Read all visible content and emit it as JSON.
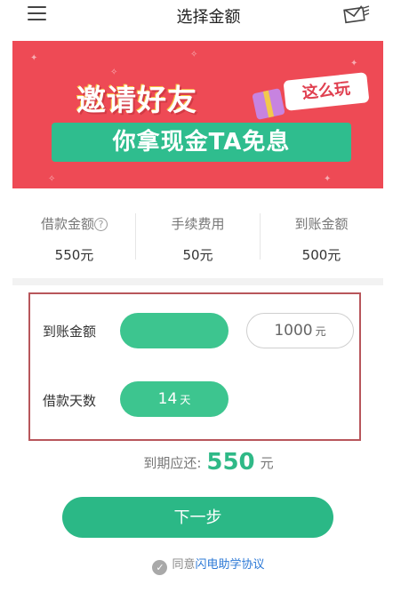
{
  "header": {
    "title": "选择金额",
    "menu_icon": "menu-icon",
    "mail_icon": "mail-icon"
  },
  "banner": {
    "headline": "邀请好友",
    "tag": "这么玩",
    "subline": "你拿现金TA免息",
    "colors": {
      "background": "#ee4a55",
      "strip": "#2fbd8e"
    }
  },
  "fees": [
    {
      "label": "借款金额",
      "value": "550元",
      "has_help_icon": true
    },
    {
      "label": "手续费用",
      "value": "50元"
    },
    {
      "label": "到账金额",
      "value": "500元"
    }
  ],
  "amount_selector": {
    "label": "到账金额",
    "options": [
      {
        "value": "",
        "unit": "",
        "selected": true
      },
      {
        "value": "1000",
        "unit": "元",
        "selected": false
      }
    ]
  },
  "days_selector": {
    "label": "借款天数",
    "options": [
      {
        "value": "14",
        "unit": "天",
        "selected": true
      }
    ]
  },
  "due": {
    "label": "到期应还:",
    "amount": "550",
    "unit": "元"
  },
  "next_button": {
    "label": "下一步"
  },
  "agreement": {
    "prefix": "同意",
    "link_text": "闪电助学协议",
    "checked": true
  },
  "colors": {
    "accent": "#2bb886",
    "link": "#2b78d6",
    "highlight_border": "#b8565b"
  }
}
